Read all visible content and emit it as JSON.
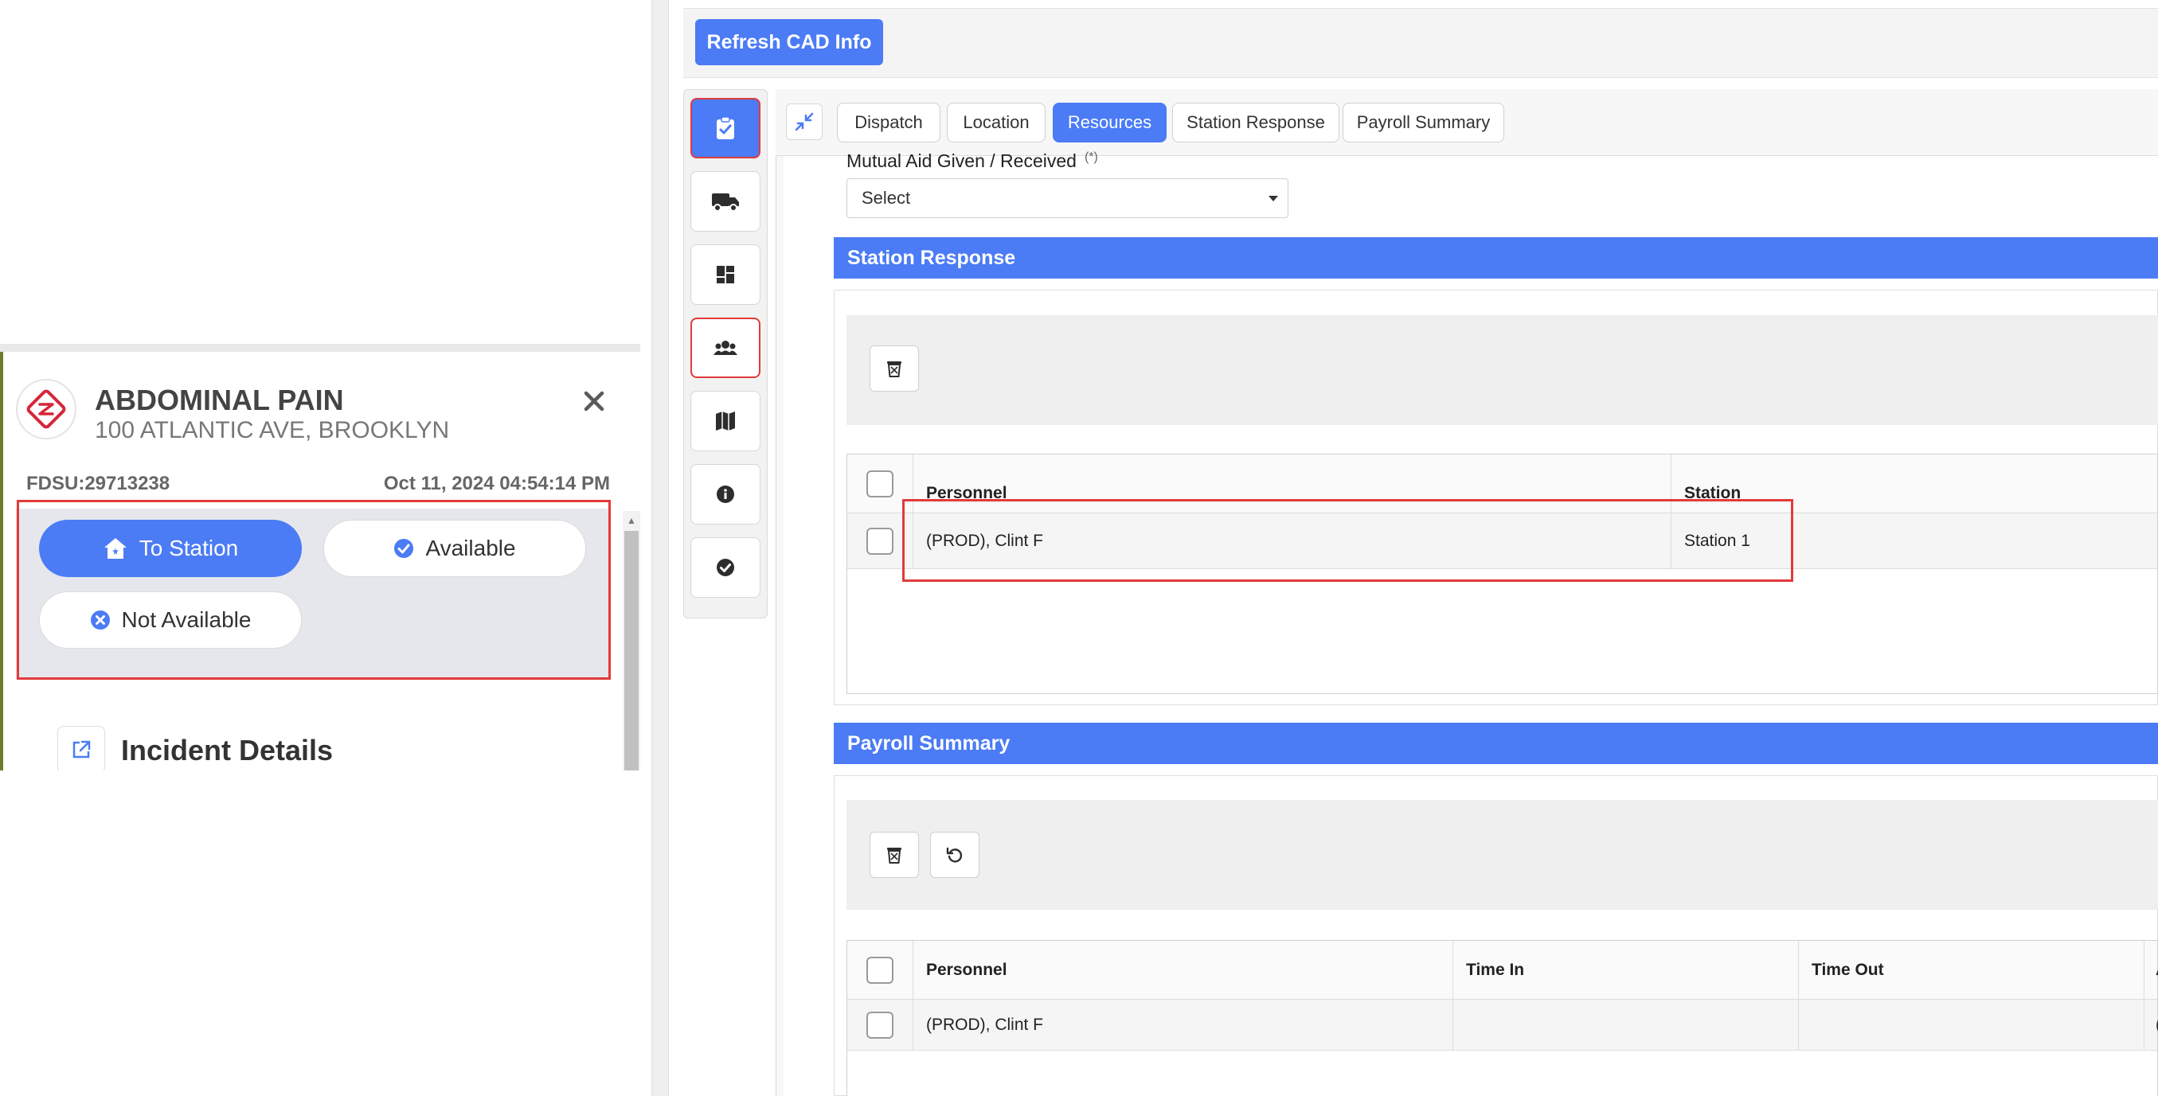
{
  "incident": {
    "title": "ABDOMINAL PAIN",
    "address": "100 ATLANTIC AVE, BROOKLYN",
    "id": "FDSU:29713238",
    "datetime": "Oct 11, 2024 04:54:14 PM",
    "details_label": "Incident Details"
  },
  "status_buttons": {
    "to_station": "To Station",
    "available": "Available",
    "not_available": "Not Available"
  },
  "toolbar": {
    "refresh_label": "Refresh CAD Info"
  },
  "tabs": [
    {
      "label": "Dispatch"
    },
    {
      "label": "Location"
    },
    {
      "label": "Resources",
      "active": true
    },
    {
      "label": "Station Response"
    },
    {
      "label": "Payroll Summary"
    }
  ],
  "mutual_aid": {
    "label": "Mutual Aid Given / Received",
    "required_marker": "(*)",
    "selected": "Select"
  },
  "station_response": {
    "title": "Station Response",
    "columns": [
      "Personnel",
      "Station"
    ],
    "rows": [
      {
        "personnel": "(PROD), Clint F",
        "station": "Station 1"
      }
    ]
  },
  "payroll_summary": {
    "title": "Payroll Summary",
    "columns": [
      "Personnel",
      "Time In",
      "Time Out",
      "A"
    ],
    "rows": [
      {
        "personnel": "(PROD), Clint F",
        "time_in": "",
        "time_out": "",
        "extra": "("
      }
    ]
  },
  "colors": {
    "accent": "#4b7bf5",
    "highlight": "#e23a3a"
  }
}
